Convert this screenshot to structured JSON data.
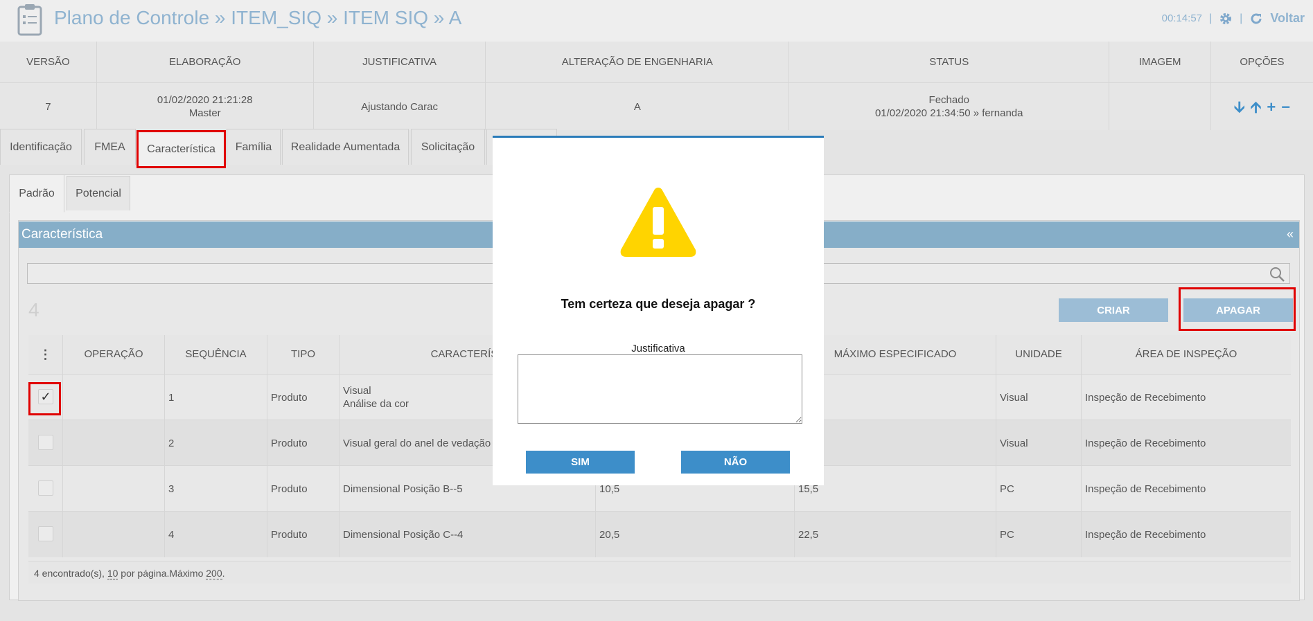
{
  "header": {
    "title": "Plano de Controle » ITEM_SIQ » ITEM SIQ » A",
    "clock": "00:14:57",
    "sep1": "|",
    "sep2": "|",
    "back_label": "Voltar"
  },
  "version_table": {
    "headers": [
      "VERSÃO",
      "ELABORAÇÃO",
      "JUSTIFICATIVA",
      "ALTERAÇÃO DE ENGENHARIA",
      "STATUS",
      "IMAGEM",
      "OPÇÕES"
    ],
    "row": {
      "versao": "7",
      "elaboracao_date": "01/02/2020 21:21:28",
      "elaboracao_user": "Master",
      "justificativa": "Ajustando Carac",
      "alteracao": "A",
      "status": "Fechado",
      "status_detail": "01/02/2020 21:34:50 » fernanda",
      "imagem": ""
    },
    "options": {
      "down": "🡫",
      "up": "🡩",
      "add": "+",
      "remove": "−"
    }
  },
  "tabs": [
    {
      "label": "Identificação"
    },
    {
      "label": "FMEA"
    },
    {
      "label": "Característica"
    },
    {
      "label": "Família"
    },
    {
      "label": "Realidade Aumentada"
    },
    {
      "label": "Solicitação"
    }
  ],
  "subtabs": [
    {
      "label": "Padrão"
    },
    {
      "label": "Potencial"
    }
  ],
  "panel": {
    "title": "Característica",
    "collapse": "«",
    "search_value": "",
    "count": "4",
    "create_label": "CRIAR",
    "delete_label": "APAGAR"
  },
  "grid": {
    "menu_icon": "⋮",
    "columns": [
      "OPERAÇÃO",
      "SEQUÊNCIA",
      "TIPO",
      "CARACTERÍST",
      "MÁXIMO ESPECIFICADO",
      "UNIDADE",
      "ÁREA DE INSPEÇÃO"
    ],
    "rows": [
      {
        "checked": true,
        "operacao": "",
        "sequencia": "1",
        "tipo": "Produto",
        "carac1": "Visual",
        "carac2": "Análise da cor",
        "minimo": "",
        "maximo": "",
        "unidade": "Visual",
        "area": "Inspeção de Recebimento"
      },
      {
        "checked": false,
        "operacao": "",
        "sequencia": "2",
        "tipo": "Produto",
        "carac1": "Visual geral do anel de vedação",
        "carac2": "",
        "minimo": "",
        "maximo": "",
        "unidade": "Visual",
        "area": "Inspeção de Recebimento"
      },
      {
        "checked": false,
        "operacao": "",
        "sequencia": "3",
        "tipo": "Produto",
        "carac1": "Dimensional Posição B--5",
        "carac2": "",
        "minimo": "10,5",
        "maximo": "15,5",
        "unidade": "PC",
        "area": "Inspeção de Recebimento"
      },
      {
        "checked": false,
        "operacao": "",
        "sequencia": "4",
        "tipo": "Produto",
        "carac1": "Dimensional Posição C--4",
        "carac2": "",
        "minimo": "20,5",
        "maximo": "22,5",
        "unidade": "PC",
        "area": "Inspeção de Recebimento"
      }
    ],
    "footer": {
      "found": "4 encontrado(s), ",
      "per_page": "10",
      "per_page_text": " por página.Máximo ",
      "max": "200",
      "end": "."
    }
  },
  "dialog": {
    "message": "Tem certeza que deseja apagar ?",
    "field_label": "Justificativa",
    "field_value": "",
    "yes_label": "SIM",
    "no_label": "NÃO"
  },
  "colors": {
    "accent": "#3d8ec9",
    "panel_header": "#86aec8",
    "highlight": "#e00000",
    "warning": "#ffd400"
  }
}
